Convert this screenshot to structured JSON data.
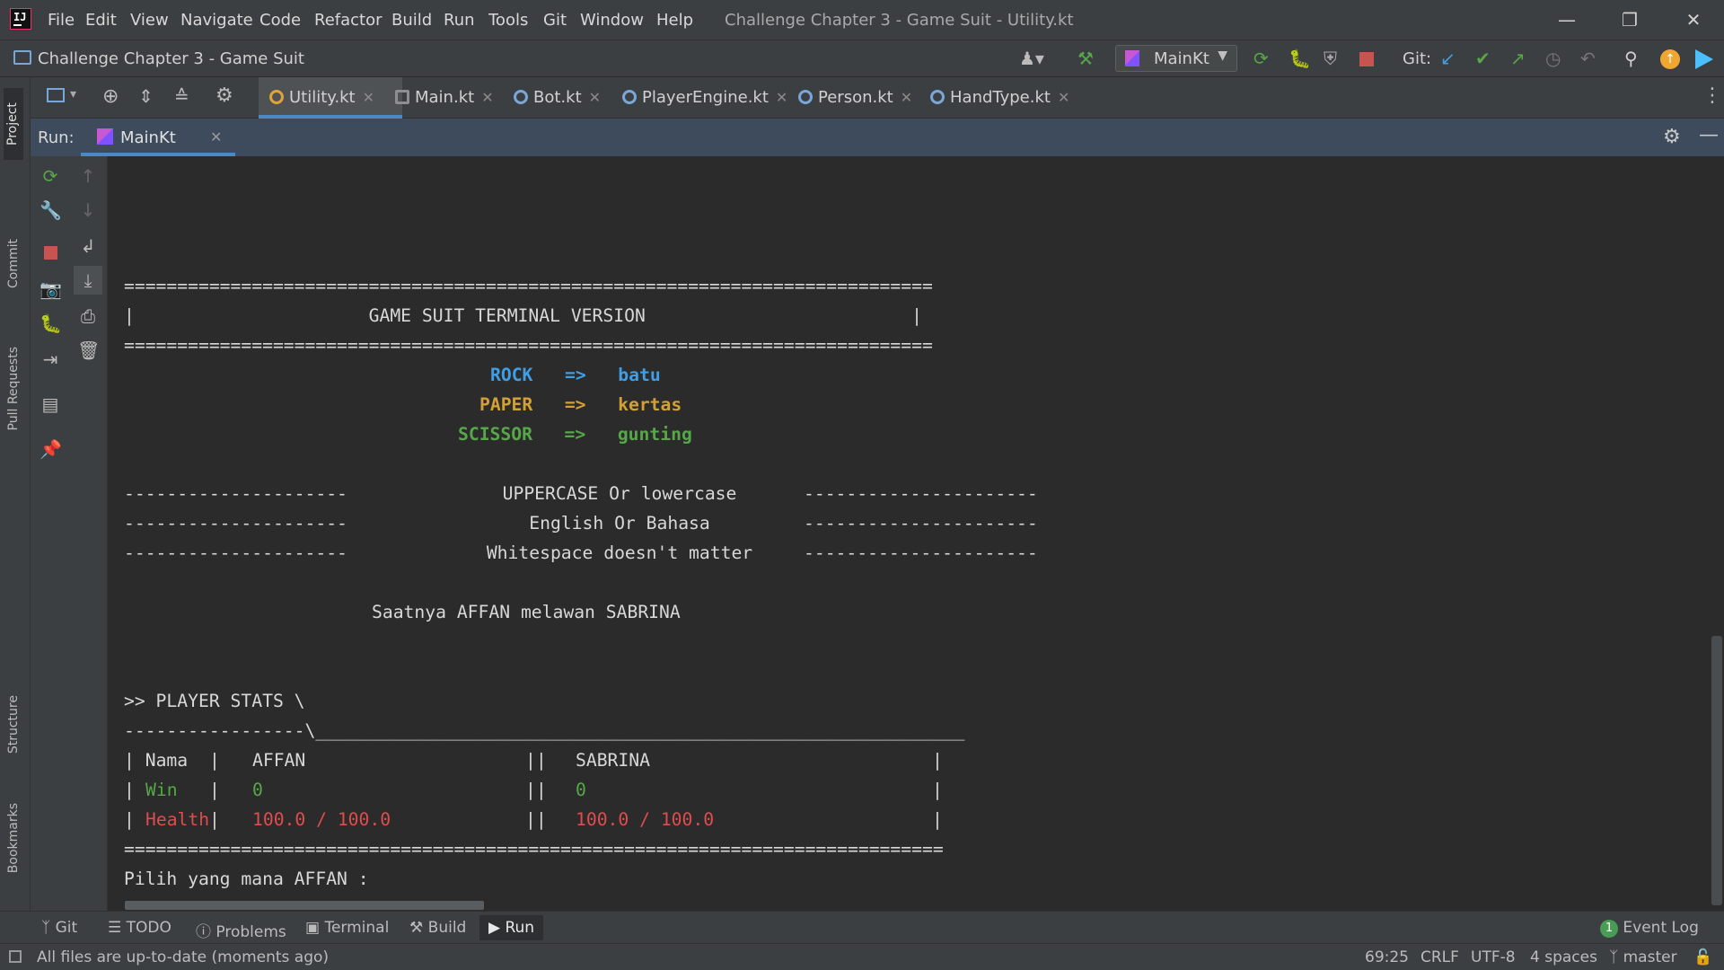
{
  "window": {
    "title": "Challenge Chapter 3 - Game Suit - Utility.kt",
    "menu": [
      "File",
      "Edit",
      "View",
      "Navigate",
      "Code",
      "Refactor",
      "Build",
      "Run",
      "Tools",
      "Git",
      "Window",
      "Help"
    ]
  },
  "navbar": {
    "project_name": "Challenge Chapter 3 - Game Suit",
    "run_config": "MainKt",
    "git_label": "Git:"
  },
  "left_strip": {
    "project": "Project",
    "commit": "Commit",
    "pull_requests": "Pull Requests",
    "structure": "Structure",
    "bookmarks": "Bookmarks"
  },
  "tabs": [
    {
      "label": "Utility.kt",
      "active": true
    },
    {
      "label": "Main.kt",
      "active": false
    },
    {
      "label": "Bot.kt",
      "active": false
    },
    {
      "label": "PlayerEngine.kt",
      "active": false
    },
    {
      "label": "Person.kt",
      "active": false
    },
    {
      "label": "HandType.kt",
      "active": false
    }
  ],
  "run_panel": {
    "label": "Run:",
    "tab": "MainKt"
  },
  "console": {
    "sep_eq": "============================================================================",
    "header": "|                      GAME SUIT TERMINAL VERSION                         |",
    "rock_a": "ROCK",
    "rock_arrow": "=>",
    "rock_b": "batu",
    "paper_a": "PAPER",
    "paper_arrow": "=>",
    "paper_b": "kertas",
    "scissor_a": "SCISSOR",
    "scissor_arrow": "=>",
    "scissor_b": "gunting",
    "dash_left": "---------------------",
    "dash_right": "----------------------",
    "rule1": "UPPERCASE Or lowercase",
    "rule2": "English Or Bahasa",
    "rule3": "Whitespace doesn't matter",
    "versus": "Saatnya AFFAN melawan SABRINA",
    "stats_title": ">> PLAYER STATS \\",
    "stats_line": "-----------------\\_____________________________________________________________",
    "row_nama_pipe": "|",
    "row_nama_label": "Nama",
    "row_nama_p1": "AFFAN",
    "row_nama_p2": "SABRINA",
    "row_win_label": "Win",
    "row_win_p1": "0",
    "row_win_p2": "0",
    "row_health_label": "Health",
    "row_health_p1": "100.0 / 100.0",
    "row_health_p2": "100.0 / 100.0",
    "sep_eq2": "=============================================================================",
    "prompt": "Pilih yang mana AFFAN :"
  },
  "bottom_tools": {
    "git": "Git",
    "todo": "TODO",
    "problems": "Problems",
    "terminal": "Terminal",
    "build": "Build",
    "run": "Run",
    "event_log": "Event Log",
    "event_count": "1"
  },
  "status": {
    "message": "All files are up-to-date (moments ago)",
    "position": "69:25",
    "line_sep": "CRLF",
    "encoding": "UTF-8",
    "indent": "4 spaces",
    "branch": "master"
  },
  "colors": {
    "accent": "#4a88c7",
    "rock": "#3f9ee6",
    "paper": "#d4a035",
    "scissor": "#57a64a",
    "health": "#e04c4c"
  }
}
